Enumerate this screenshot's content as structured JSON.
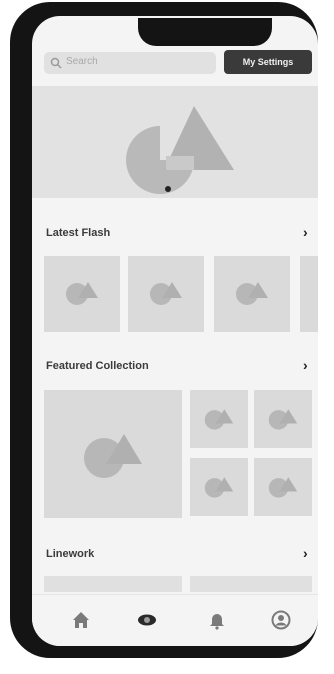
{
  "search": {
    "placeholder": "Search",
    "icon": "search-icon"
  },
  "header": {
    "profile_button_label": "My Settings"
  },
  "hero": {
    "icon": "image-placeholder-icon"
  },
  "sections": [
    {
      "title": "Latest Flash",
      "chevron": "›"
    },
    {
      "title": "Featured Collection",
      "chevron": "›"
    },
    {
      "title": "Linework",
      "chevron": "›"
    }
  ],
  "tabbar": {
    "items": [
      "home-icon",
      "eye-icon",
      "bell-icon",
      "profile-icon"
    ]
  },
  "colors": {
    "frame": "#141414",
    "screen": "#f4f4f4",
    "placeholder": "#dadada",
    "button": "#3a3a3a"
  }
}
